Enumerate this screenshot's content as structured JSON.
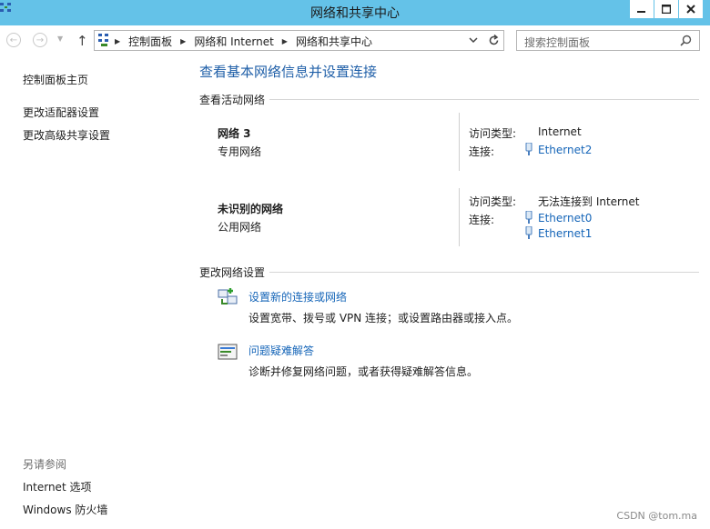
{
  "window": {
    "title": "网络和共享中心"
  },
  "address": {
    "crumbs": [
      "控制面板",
      "网络和 Internet",
      "网络和共享中心"
    ]
  },
  "search": {
    "placeholder": "搜索控制面板"
  },
  "sidebar": {
    "home": "控制面板主页",
    "items": [
      "更改适配器设置",
      "更改高级共享设置"
    ],
    "see_also_label": "另请参阅",
    "see_also": [
      "Internet 选项",
      "Windows 防火墙"
    ]
  },
  "main": {
    "title": "查看基本网络信息并设置连接",
    "active_networks_label": "查看活动网络",
    "networks": [
      {
        "name": "网络  3",
        "category": "专用网络",
        "access_label": "访问类型:",
        "access_value": "Internet",
        "conn_label": "连接:",
        "connections": [
          "Ethernet2"
        ]
      },
      {
        "name": "未识别的网络",
        "category": "公用网络",
        "access_label": "访问类型:",
        "access_value": "无法连接到 Internet",
        "conn_label": "连接:",
        "connections": [
          "Ethernet0",
          "Ethernet1"
        ]
      }
    ],
    "change_label": "更改网络设置",
    "tasks": [
      {
        "link": "设置新的连接或网络",
        "desc": "设置宽带、拨号或 VPN 连接；或设置路由器或接入点。",
        "icon": "network-setup-icon"
      },
      {
        "link": "问题疑难解答",
        "desc": "诊断并修复网络问题，或者获得疑难解答信息。",
        "icon": "troubleshoot-icon"
      }
    ]
  },
  "watermark": "CSDN @tom.ma",
  "colors": {
    "titlebar": "#64c2e8",
    "link": "#1565b8",
    "title": "#1f5fa8"
  }
}
